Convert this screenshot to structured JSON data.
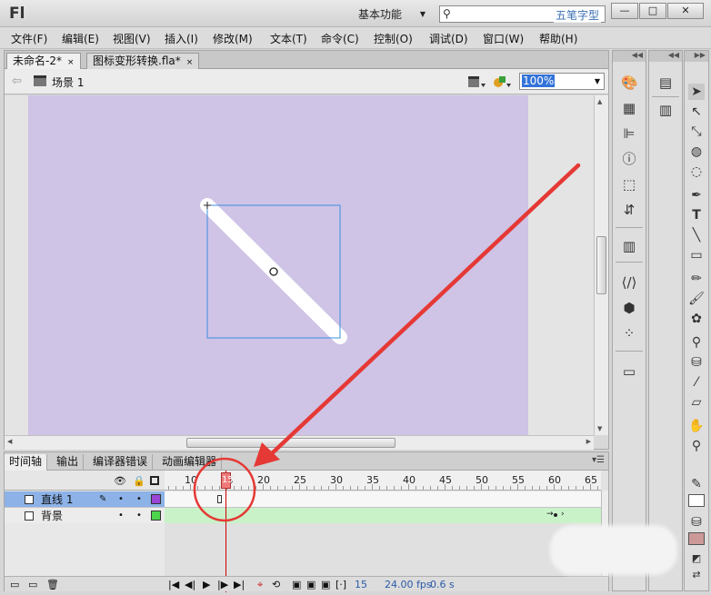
{
  "app": {
    "logo": "Fl",
    "workspace_label": "基本功能",
    "search_placeholder": "",
    "watermark": "五笔字型",
    "min_glyph": "—",
    "max_glyph": "□",
    "close_glyph": "✕"
  },
  "menu": [
    "文件(F)",
    "编辑(E)",
    "视图(V)",
    "插入(I)",
    "修改(M)",
    "文本(T)",
    "命令(C)",
    "控制(O)",
    "调试(D)",
    "窗口(W)",
    "帮助(H)"
  ],
  "doc_tabs": [
    {
      "label": "未命名-2*",
      "close": "×"
    },
    {
      "label": "图标变形转换.fla*",
      "close": "×"
    }
  ],
  "editbar": {
    "back_glyph": "⇦",
    "scene_label": "场景 1",
    "zoom": "100%"
  },
  "timeline": {
    "tabs": [
      "时间轴",
      "输出",
      "编译器错误",
      "动画编辑器"
    ],
    "ruler_numbers": [
      "10",
      "15",
      "20",
      "25",
      "30",
      "35",
      "40",
      "45",
      "50",
      "55",
      "60",
      "65"
    ],
    "current_frame_marker": "15",
    "layers": [
      {
        "name": "直线 1",
        "selected": true,
        "color": "#9a45d6"
      },
      {
        "name": "背景",
        "selected": false,
        "color": "#4cd44c"
      }
    ],
    "status": {
      "frame": "15",
      "fps": "24.00 fps",
      "time": "0.6 s"
    }
  },
  "colors": {
    "stage": "#cfc3e6",
    "selection_blue": "#3b8fe0",
    "annotation_red": "#e53935",
    "stroke_swatch": "#ffffff",
    "fill_swatch": "#cc9999"
  },
  "icons": {
    "left_strip": [
      "color-palette-icon",
      "swatches-grid-icon",
      "align-icon",
      "info-icon",
      "transform-icon",
      "motion-presets-icon",
      "library-icon",
      "code-snippets-icon",
      "components-icon",
      "movie-explorer-icon",
      "screen-icon"
    ],
    "middle_strip": [
      "properties-icon",
      "library-books-icon"
    ],
    "tools": [
      "selection-tool-icon",
      "subselection-tool-icon",
      "free-transform-icon",
      "3d-rotation-icon",
      "lasso-icon",
      "pen-icon",
      "text-tool-icon",
      "line-tool-icon",
      "rectangle-tool-icon",
      "pencil-icon",
      "brush-icon",
      "deco-icon",
      "bone-icon",
      "paint-bucket-icon",
      "eyedropper-icon",
      "eraser-icon",
      "hand-icon",
      "zoom-icon"
    ]
  }
}
